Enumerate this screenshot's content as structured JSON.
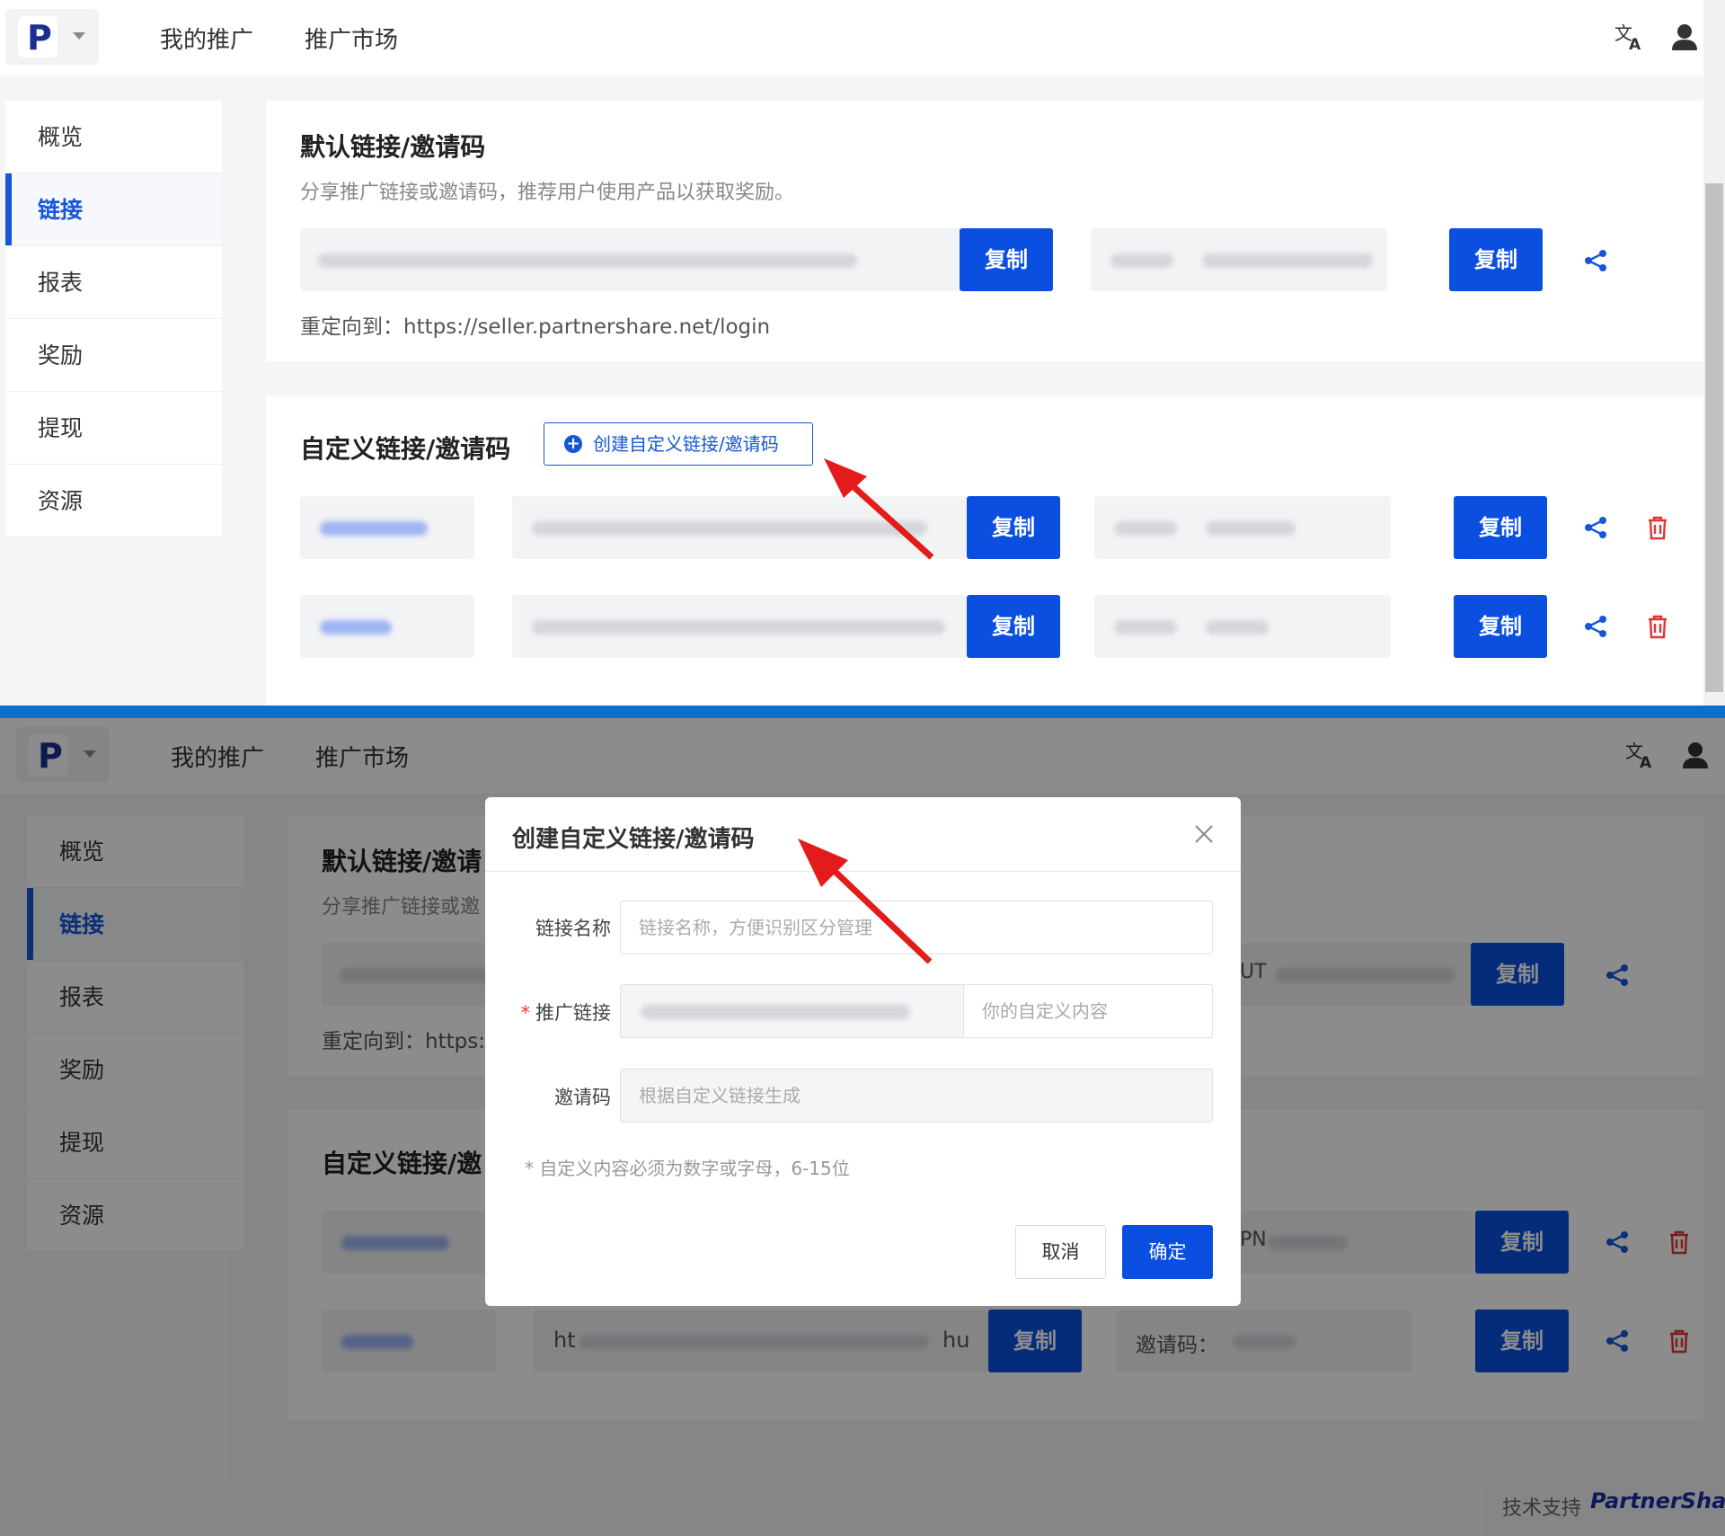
{
  "header": {
    "logo": "P",
    "nav": [
      "我的推广",
      "推广市场"
    ],
    "translate_icon": "translate-icon",
    "user_icon": "user-icon"
  },
  "sidebar": {
    "items": [
      {
        "label": "概览",
        "active": false
      },
      {
        "label": "链接",
        "active": true
      },
      {
        "label": "报表",
        "active": false
      },
      {
        "label": "奖励",
        "active": false
      },
      {
        "label": "提现",
        "active": false
      },
      {
        "label": "资源",
        "active": false
      }
    ]
  },
  "default_card": {
    "title": "默认链接/邀请码",
    "subtitle": "分享推广链接或邀请码，推荐用户使用产品以获取奖励。",
    "copy_label": "复制",
    "redirect_label": "重定向到：https://seller.partnershare.net/login"
  },
  "custom_card": {
    "title": "自定义链接/邀请码",
    "create_button": "创建自定义链接/邀请码",
    "copy_label": "复制"
  },
  "lower_view": {
    "default_title_partial": "默认链接/邀请",
    "subtitle_partial": "分享推广链接或邀",
    "redirect_partial": "重定向到：https:/",
    "custom_title_partial": "自定义链接/邀",
    "link_prefix": "ht",
    "link_suffix": "hu",
    "invite_code_label": "邀请码：",
    "code_prefix_a": "UT",
    "code_prefix_b": "PN"
  },
  "modal": {
    "title": "创建自定义链接/邀请码",
    "name_label": "链接名称",
    "name_placeholder": "链接名称，方便识别区分管理",
    "link_label": "推广链接",
    "link_custom_placeholder": "你的自定义内容",
    "code_label": "邀请码",
    "code_placeholder": "根据自定义链接生成",
    "hint": "* 自定义内容必须为数字或字母，6-15位",
    "cancel": "取消",
    "confirm": "确定"
  },
  "footer": {
    "support_label": "技术支持",
    "brand": "PartnerShare"
  },
  "colors": {
    "accent": "#0a4fe0",
    "active_blue": "#1657d9",
    "danger": "#e33333",
    "divider": "#0b6fd0",
    "arrow": "#e31b1b"
  }
}
